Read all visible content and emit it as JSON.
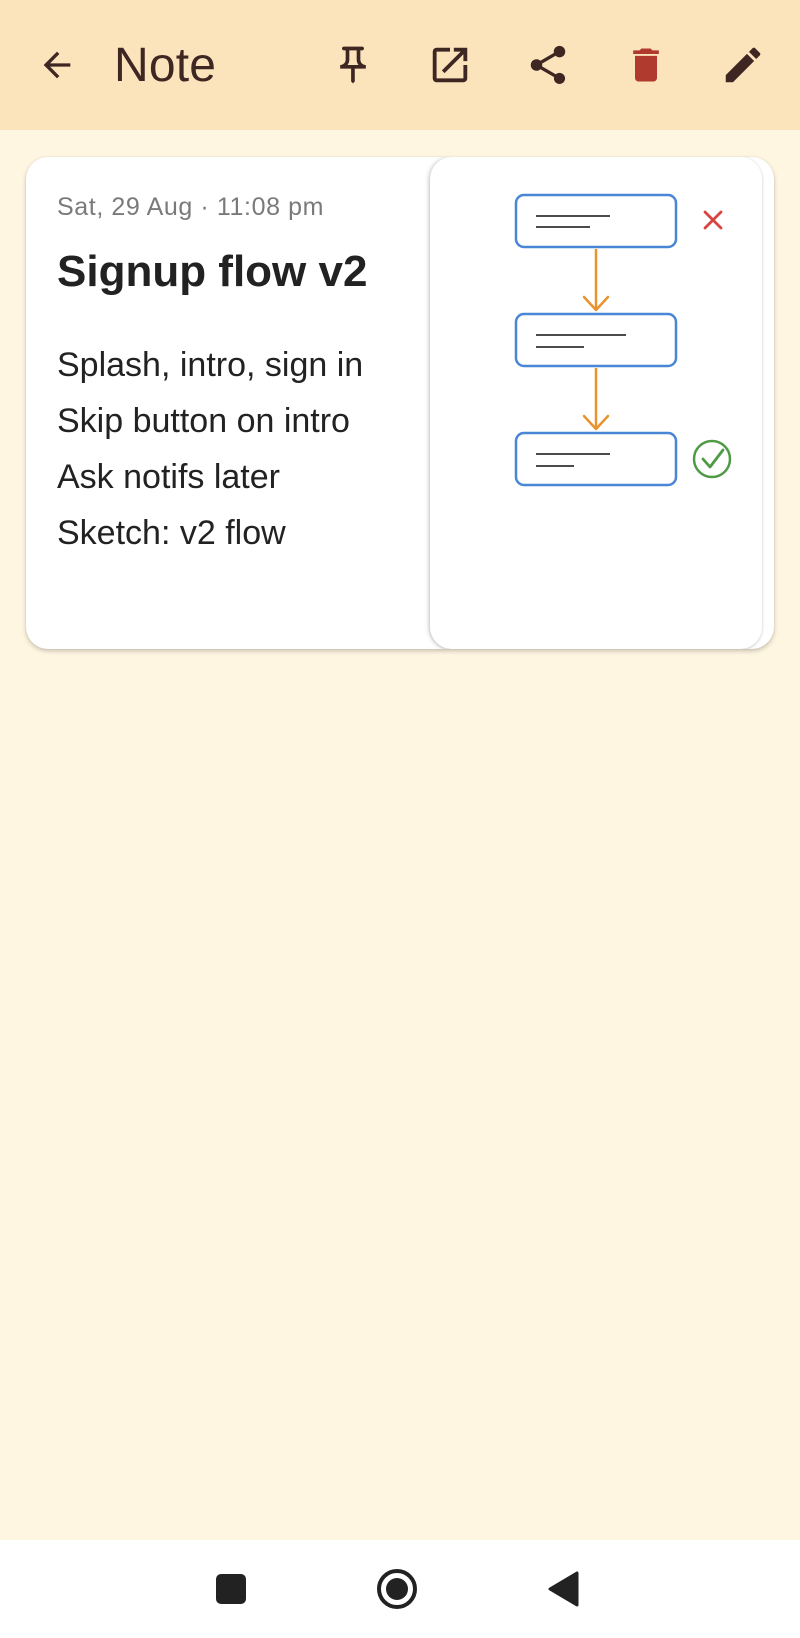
{
  "app_bar": {
    "title": "Note",
    "icons": {
      "back": "arrow-back-icon",
      "pin": "pin-icon",
      "open": "open-external-icon",
      "share": "share-icon",
      "delete": "trash-icon",
      "edit": "pencil-icon"
    }
  },
  "note": {
    "date": "Sat, 29 Aug · 11:08 pm",
    "title": "Signup flow v2",
    "lines": [
      "Splash, intro, sign in",
      "Skip button on intro",
      "Ask notifs later",
      "Sketch: v2 flow"
    ],
    "sketch": {
      "box_count": 3,
      "marks": [
        "close-x-icon",
        "check-circle-icon"
      ]
    }
  },
  "nav": {
    "icons": [
      "recents-square-icon",
      "home-circle-icon",
      "back-triangle-icon"
    ]
  },
  "colors": {
    "app_bar_bg": "#FBE3BC",
    "page_bg": "#FEF6E0",
    "icon_color": "#3E2723",
    "delete_color": "#B03A2E",
    "sketch_box": "#4A86D6",
    "sketch_arrow": "#E8932E",
    "sketch_x": "#D64541",
    "sketch_check": "#4F9A45"
  }
}
